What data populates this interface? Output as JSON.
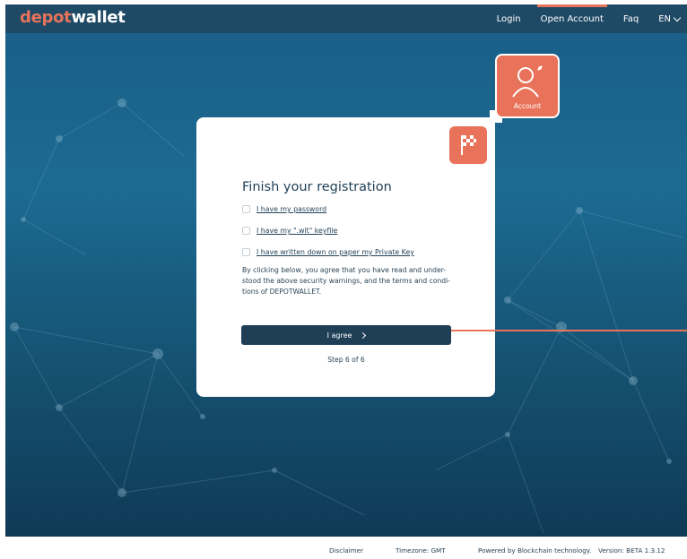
{
  "header": {
    "logo_part1": "depot",
    "logo_part2": "wallet",
    "nav": {
      "login": "Login",
      "open_account": "Open Account",
      "faq": "Faq",
      "language": "EN"
    }
  },
  "account_tab": {
    "label": "Account"
  },
  "card": {
    "title": "Finish your registration",
    "checkboxes": [
      {
        "label": "I have my password",
        "checked": false
      },
      {
        "label": "I have my \".wlt\" keyfile",
        "checked": false
      },
      {
        "label": "I have written down on paper my Private Key",
        "checked": false
      }
    ],
    "terms_lines": [
      "By clicking below, you agree that you have read and under-",
      "stood the above security warnings, and the terms and condi-",
      "tions of DEPOTWALLET."
    ],
    "agree_button": "I agree",
    "step": "Step 6 of 6"
  },
  "footer": {
    "disclaimer": "Disclaimer",
    "timezone": "Timezone: GMT",
    "powered": "Powered by Blockchain technology.",
    "version": "Version: BETA 1.3.12"
  },
  "colors": {
    "accent": "#e8735a",
    "header_bg": "#1f4a66",
    "button_bg": "#1f3f57"
  }
}
